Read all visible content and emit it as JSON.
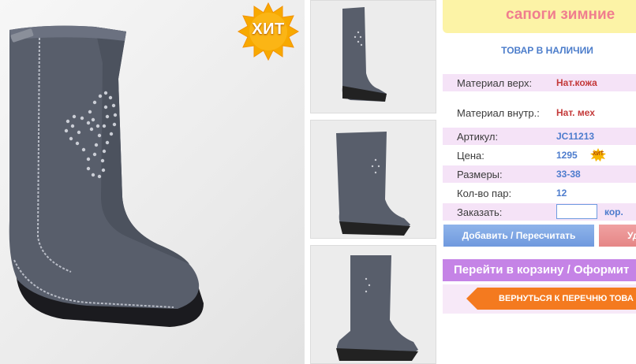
{
  "hit_badge": "ХИТ",
  "title": "сапоги зимние",
  "stock_status": "ТОВАР В НАЛИЧИИ",
  "specs": [
    {
      "label": "Материал верх:",
      "value": "Нат.кожа"
    },
    {
      "label": "Материал внутр.:",
      "value": "Нат. мех"
    },
    {
      "label": "Артикул:",
      "value": "JC11213"
    },
    {
      "label": "Цена:",
      "value": "1295"
    },
    {
      "label": "Размеры:",
      "value": "33-38"
    },
    {
      "label": "Кол-во пар:",
      "value": "12"
    },
    {
      "label": "Заказать:",
      "value": ""
    }
  ],
  "price_hit_badge": "ХИТ",
  "order_unit": "кор.",
  "buttons": {
    "add": "Добавить / Пересчитать",
    "delete": "Уд",
    "cart": "Перейти в корзину / Оформит",
    "back": "ВЕРНУТЬСЯ К ПЕРЕЧНЮ ТОВА"
  },
  "colors": {
    "title_bg": "#fcf3a6",
    "title_text": "#f07d8f",
    "stock_text": "#4c7dcb",
    "row_pink": "#f5e3f7",
    "value_red": "#c43a3a",
    "value_blue": "#4d7ccd",
    "add_button": "#7ea6e4",
    "delete_button": "#eb9494",
    "cart_button": "#c583e6",
    "back_button": "#f47a1f",
    "hit_badge": "#f7a900"
  }
}
